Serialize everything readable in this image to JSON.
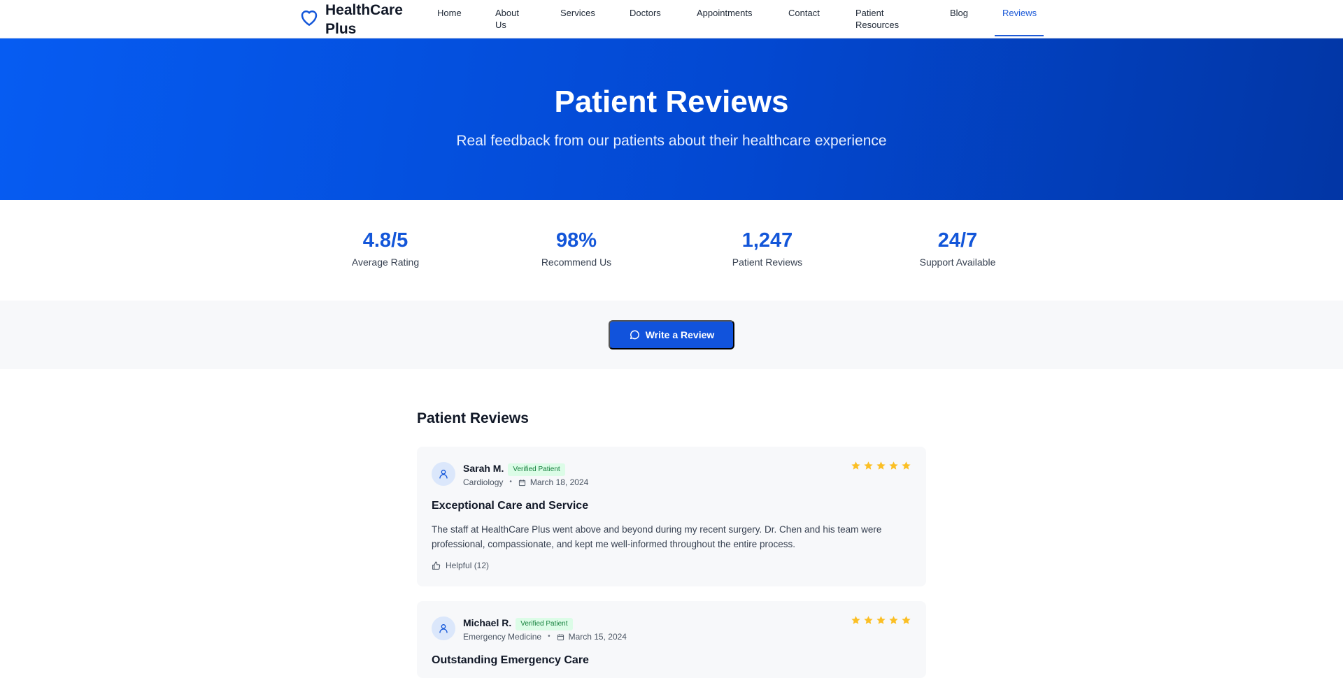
{
  "brand": {
    "name": "HealthCare Plus"
  },
  "nav": [
    {
      "label": "Home"
    },
    {
      "label": "About Us"
    },
    {
      "label": "Services"
    },
    {
      "label": "Doctors"
    },
    {
      "label": "Appointments"
    },
    {
      "label": "Contact"
    },
    {
      "label": "Patient Resources"
    },
    {
      "label": "Blog"
    },
    {
      "label": "Reviews",
      "active": true
    }
  ],
  "hero": {
    "title": "Patient Reviews",
    "subtitle": "Real feedback from our patients about their healthcare experience"
  },
  "stats": [
    {
      "value": "4.8/5",
      "label": "Average Rating"
    },
    {
      "value": "98%",
      "label": "Recommend Us"
    },
    {
      "value": "1,247",
      "label": "Patient Reviews"
    },
    {
      "value": "24/7",
      "label": "Support Available"
    }
  ],
  "cta": {
    "label": "Write a Review",
    "icon": "chat-bubble-icon"
  },
  "reviews_section": {
    "title": "Patient Reviews"
  },
  "reviews": [
    {
      "name": "Sarah M.",
      "badge": "Verified Patient",
      "department": "Cardiology",
      "date": "March 18, 2024",
      "rating": 5,
      "title": "Exceptional Care and Service",
      "body": "The staff at HealthCare Plus went above and beyond during my recent surgery. Dr. Chen and his team were professional, compassionate, and kept me well-informed throughout the entire process.",
      "helpful": "Helpful (12)"
    },
    {
      "name": "Michael R.",
      "badge": "Verified Patient",
      "department": "Emergency Medicine",
      "date": "March 15, 2024",
      "rating": 5,
      "title": "Outstanding Emergency Care"
    }
  ],
  "colors": {
    "primary": "#1153dc",
    "hero_start": "#065cf2",
    "hero_end": "#0236a5",
    "star": "#fbbf24",
    "badge_bg": "#dcfce7",
    "badge_text": "#15803d"
  }
}
